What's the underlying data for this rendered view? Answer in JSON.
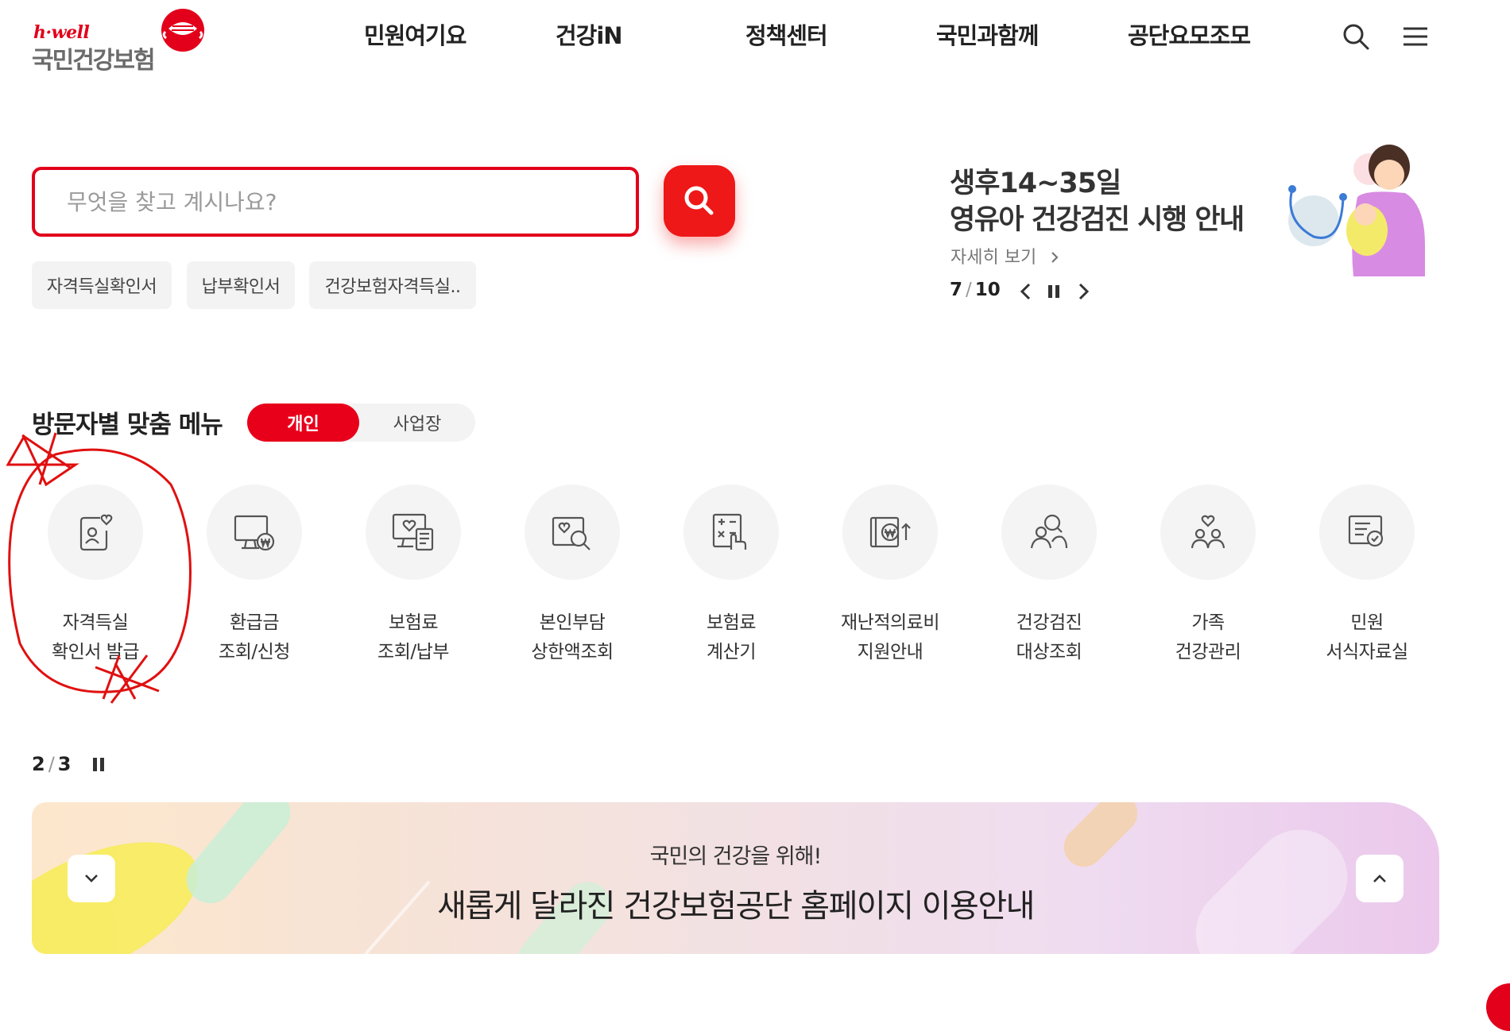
{
  "brand": {
    "logo_en": "h·well",
    "logo_ko": "국민건강보험",
    "accent_color": "#e2001a"
  },
  "header": {
    "nav": [
      "민원여기요",
      "건강iN",
      "정책센터",
      "국민과함께",
      "공단요모조모"
    ],
    "icons": [
      "search-icon",
      "hamburger-menu-icon"
    ]
  },
  "search": {
    "placeholder": "무엇을 찾고 계시나요?",
    "keywords": [
      "자격득실확인서",
      "납부확인서",
      "건강보험자격득실.."
    ]
  },
  "banner": {
    "line1": "생후14~35일",
    "line2": "영유아 건강검진 시행 안내",
    "more": "자세히 보기",
    "current": "7",
    "total": "10"
  },
  "visitor_menu": {
    "title": "방문자별 맞춤 메뉴",
    "tab_on": "개인",
    "tab_off": "사업장",
    "items": [
      {
        "l1": "자격득실",
        "l2": "확인서 발급"
      },
      {
        "l1": "환급금",
        "l2": "조회/신청"
      },
      {
        "l1": "보험료",
        "l2": "조회/납부"
      },
      {
        "l1": "본인부담",
        "l2": "상한액조회"
      },
      {
        "l1": "보험료",
        "l2": "계산기"
      },
      {
        "l1": "재난적의료비",
        "l2": "지원안내"
      },
      {
        "l1": "건강검진",
        "l2": "대상조회"
      },
      {
        "l1": "가족",
        "l2": "건강관리"
      },
      {
        "l1": "민원",
        "l2": "서식자료실"
      }
    ],
    "page_current": "2",
    "page_total": "3"
  },
  "notice": {
    "sub": "국민의 건강을 위해!",
    "main": "새롭게 달라진 건강보험공단 홈페이지 이용안내"
  }
}
